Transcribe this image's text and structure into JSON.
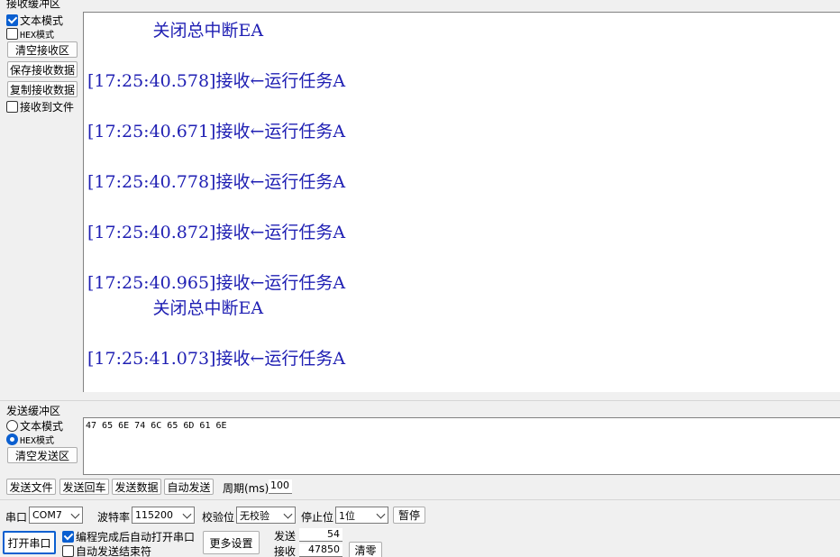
{
  "recv_panel": {
    "title": "接收缓冲区",
    "text_mode_label": "文本模式",
    "text_mode_checked": true,
    "hex_mode_label": "HEX模式",
    "hex_mode_checked": false,
    "clear_button": "清空接收区",
    "save_button": "保存接收数据",
    "copy_button": "复制接收数据",
    "to_file_label": "接收到文件",
    "to_file_checked": false,
    "lines": [
      "            关闭总中断EA",
      "",
      "[17:25:40.578]接收←运行任务A",
      "",
      "[17:25:40.671]接收←运行任务A",
      "",
      "[17:25:40.778]接收←运行任务A",
      "",
      "[17:25:40.872]接收←运行任务A",
      "",
      "[17:25:40.965]接收←运行任务A",
      "            关闭总中断EA",
      "",
      "[17:25:41.073]接收←运行任务A"
    ]
  },
  "send_panel": {
    "title": "发送缓冲区",
    "text_mode_label": "文本模式",
    "hex_mode_label": "HEX模式",
    "selected_mode": "HEX模式",
    "clear_button": "清空发送区",
    "content": "47 65 6E 74 6C 65 6D 61 6E"
  },
  "send_toolbar": {
    "send_file": "发送文件",
    "send_return": "发送回车",
    "send_data": "发送数据",
    "auto_send": "自动发送",
    "period_label": "周期(ms)",
    "period_value": "100"
  },
  "port_settings": {
    "port_label": "串口",
    "port_value": "COM7",
    "baud_label": "波特率",
    "baud_value": "115200",
    "parity_label": "校验位",
    "parity_value": "无校验",
    "stop_label": "停止位",
    "stop_value": "1位",
    "pause_button": "暂停"
  },
  "bottom": {
    "open_port_button": "打开串口",
    "auto_open_label": "编程完成后自动打开串口",
    "auto_open_checked": true,
    "auto_end_label": "自动发送结束符",
    "auto_end_checked": false,
    "more_settings_button": "更多设置",
    "send_count_label": "发送",
    "send_count": "54",
    "recv_count_label": "接收",
    "recv_count": "47850",
    "clear_count_button": "清零"
  },
  "colors": {
    "recv_text": "#1f1fb3",
    "accent": "#0a5fd0"
  }
}
